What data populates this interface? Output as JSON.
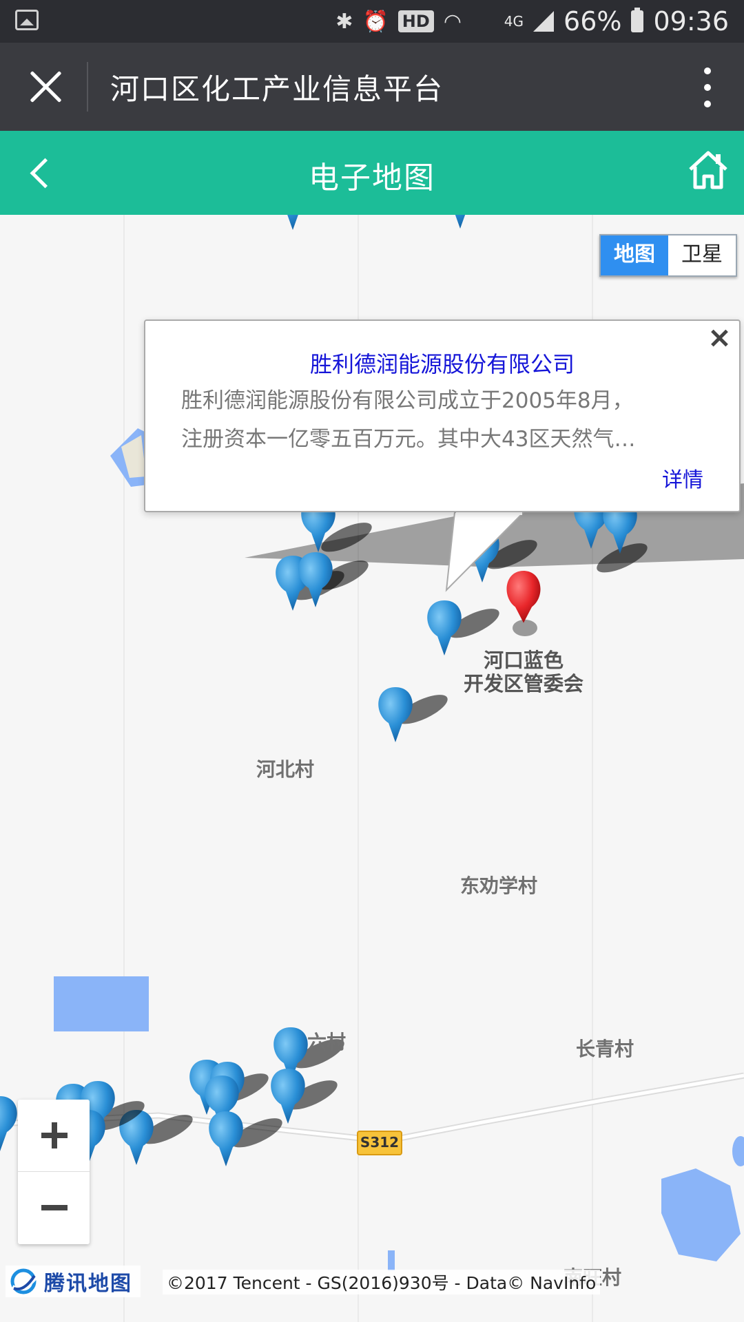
{
  "status_bar": {
    "indicators": [
      "bluetooth-icon",
      "alarm-icon",
      "wifi-icon",
      "4g-icon"
    ],
    "hd": "HD",
    "net": "4G",
    "battery": "66%",
    "time": "09:36"
  },
  "titlebar": {
    "title": "河口区化工产业信息平台"
  },
  "navbar": {
    "title": "电子地图"
  },
  "map_type": {
    "map": "地图",
    "satellite": "卫星",
    "selected": "地图"
  },
  "popup": {
    "title": "胜利德润能源股份有限公司",
    "line1": "胜利德润能源股份有限公司成立于2005年8月，",
    "line2": "注册资本一亿零五百万元。其中大43区天然气…",
    "more": "详情"
  },
  "labels": {
    "hekou_line1": "河口蓝色",
    "hekou_line2": "开发区管委会",
    "hebei": "河北村",
    "dongquanxue": "东劝学村",
    "liucun": "六村",
    "changqing": "长青村",
    "nanwang": "南旺村",
    "road": "S312"
  },
  "zoom": {
    "in": "+",
    "out": "−"
  },
  "footer": {
    "logo": "腾讯地图",
    "copyright": "©2017 Tencent - GS(2016)930号 - Data© NavInfo"
  },
  "colors": {
    "status_bar": "#2c2d32",
    "title_bar": "#3a3b40",
    "nav_bar": "#1cbd98",
    "marker_blue": "#2a8fd6",
    "marker_red": "#e8262a",
    "water": "#8ab4f8",
    "popup_link": "#1515d8"
  }
}
